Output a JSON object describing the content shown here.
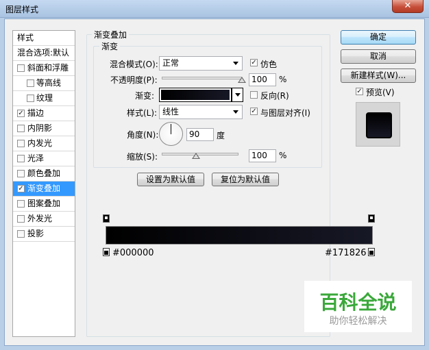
{
  "window": {
    "title": "图层样式",
    "close_glyph": "✕"
  },
  "style_list": {
    "header": "样式",
    "blend_options": "混合选项:默认",
    "items": [
      {
        "label": "斜面和浮雕",
        "checked": false,
        "indent": false
      },
      {
        "label": "等高线",
        "checked": false,
        "indent": true
      },
      {
        "label": "纹理",
        "checked": false,
        "indent": true
      },
      {
        "label": "描边",
        "checked": true,
        "indent": false
      },
      {
        "label": "内阴影",
        "checked": false,
        "indent": false
      },
      {
        "label": "内发光",
        "checked": false,
        "indent": false
      },
      {
        "label": "光泽",
        "checked": false,
        "indent": false
      },
      {
        "label": "颜色叠加",
        "checked": false,
        "indent": false
      },
      {
        "label": "渐变叠加",
        "checked": true,
        "indent": false,
        "selected": true
      },
      {
        "label": "图案叠加",
        "checked": false,
        "indent": false
      },
      {
        "label": "外发光",
        "checked": false,
        "indent": false
      },
      {
        "label": "投影",
        "checked": false,
        "indent": false
      }
    ]
  },
  "panel": {
    "group_title": "渐变叠加",
    "sub_title": "渐变",
    "blend_mode_label": "混合模式(O):",
    "blend_mode_value": "正常",
    "dither_label": "仿色",
    "dither_checked": true,
    "opacity_label": "不透明度(P):",
    "opacity_value": "100",
    "opacity_unit": "%",
    "opacity_level": 1.0,
    "gradient_label": "渐变:",
    "reverse_label": "反向(R)",
    "reverse_checked": false,
    "style_label": "样式(L):",
    "style_value": "线性",
    "align_label": "与图层对齐(I)",
    "align_checked": true,
    "angle_label": "角度(N):",
    "angle_value": "90",
    "angle_unit": "度",
    "scale_label": "缩放(S):",
    "scale_value": "100",
    "scale_unit": "%",
    "scale_level": 0.45,
    "set_default_button": "设置为默认值",
    "reset_default_button": "复位为默认值"
  },
  "gradient_editor": {
    "left_color": "#000000",
    "right_color": "#171826"
  },
  "right_buttons": {
    "ok": "确定",
    "cancel": "取消",
    "new_style": "新建样式(W)...",
    "preview_label": "预览(V)",
    "preview_checked": true
  },
  "watermark": {
    "title": "百科全说",
    "subtitle": "助你轻松解决"
  },
  "colors": {
    "accent": "#3399ff",
    "watermark_green": "#3aa83a"
  }
}
